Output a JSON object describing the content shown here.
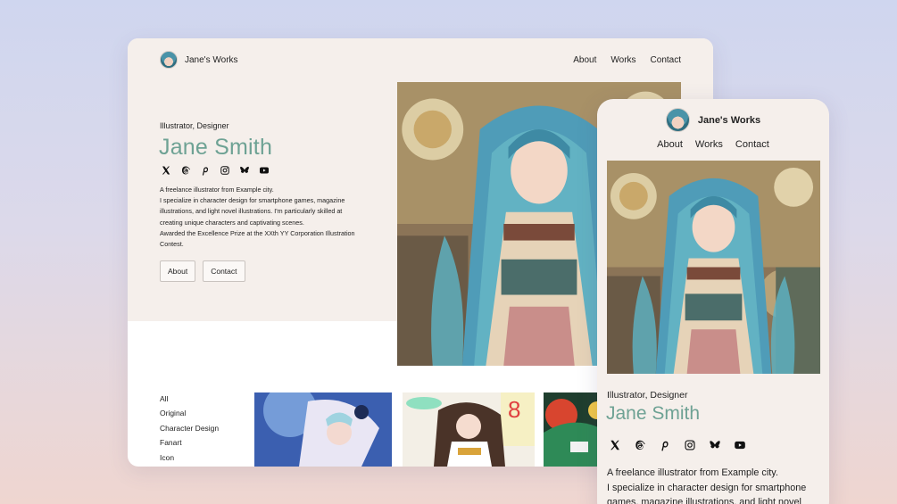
{
  "site": {
    "brand_name": "Jane's Works",
    "nav": [
      "About",
      "Works",
      "Contact"
    ]
  },
  "profile": {
    "role": "Illustrator, Designer",
    "name": "Jane Smith",
    "bio": [
      "A freelance illustrator from Example city.",
      "I specialize in character design for smartphone games, magazine",
      "illustrations, and light novel illustrations. I'm particularly skilled at",
      "creating unique characters and captivating scenes.",
      "Awarded the Excellence Prize at the XXth YY Corporation Illustration",
      "Contest."
    ],
    "mobile_bio": [
      "A freelance illustrator from Example city.",
      "I specialize in character design for smartphone",
      "games, magazine illustrations, and light novel"
    ],
    "social_icons": [
      "x-icon",
      "threads-icon",
      "pinterest-icon",
      "instagram-icon",
      "bluesky-icon",
      "youtube-icon"
    ]
  },
  "buttons": {
    "about": "About",
    "contact": "Contact"
  },
  "filters": [
    "All",
    "Original",
    "Character Design",
    "Fanart",
    "Icon"
  ],
  "colors": {
    "accent_name": "#6ea294",
    "hero_bg": "#f5efeb",
    "text": "#222222"
  }
}
